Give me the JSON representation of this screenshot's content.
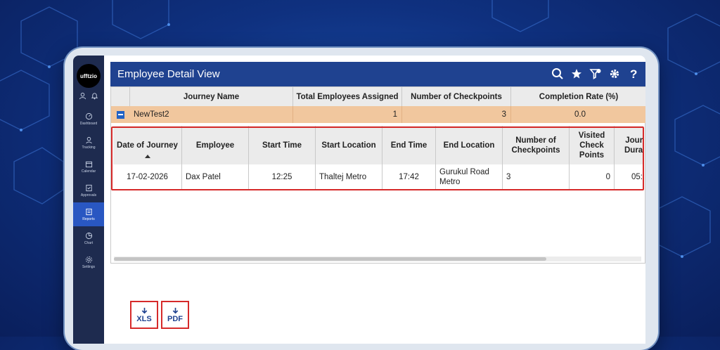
{
  "app": {
    "logo_text": "ufftzio",
    "title": "Employee Detail View"
  },
  "sidebar": {
    "items": [
      {
        "label": "Dashboard",
        "icon": "dashboard-icon"
      },
      {
        "label": "Tracking",
        "icon": "tracking-icon"
      },
      {
        "label": "Calendar",
        "icon": "calendar-icon"
      },
      {
        "label": "Approvals",
        "icon": "approvals-icon"
      },
      {
        "label": "Reports",
        "icon": "reports-icon",
        "active": true
      },
      {
        "label": "Chart",
        "icon": "chart-icon"
      },
      {
        "label": "Settings",
        "icon": "settings-icon"
      }
    ]
  },
  "summary_table": {
    "headers": [
      "Journey Name",
      "Total Employees Assigned",
      "Number of Checkpoints",
      "Completion Rate (%)"
    ],
    "group_row": {
      "name": "NewTest2",
      "total_employees": "1",
      "checkpoints": "3",
      "completion_rate": "0.0"
    }
  },
  "detail_table": {
    "headers": {
      "date": "Date of Journey",
      "employee": "Employee",
      "start_time": "Start Time",
      "start_location": "Start Location",
      "end_time": "End Time",
      "end_location": "End Location",
      "num_checkpoints": "Number of Checkpoints",
      "visited": "Visited Check Points",
      "duration": "Journey Duration"
    },
    "rows": [
      {
        "date": "17-02-2026",
        "employee": "Dax Patel",
        "start_time": "12:25",
        "start_location": "Thaltej Metro",
        "end_time": "17:42",
        "end_location": "Gurukul Road Metro",
        "num_checkpoints": "3",
        "visited": "0",
        "duration": "05:"
      }
    ]
  },
  "exports": {
    "xls_label": "XLS",
    "pdf_label": "PDF"
  },
  "colors": {
    "titlebar": "#1f4290",
    "sidebar": "#1e2b4f",
    "group_row": "#f1c79e",
    "highlight": "#d62a2a"
  }
}
